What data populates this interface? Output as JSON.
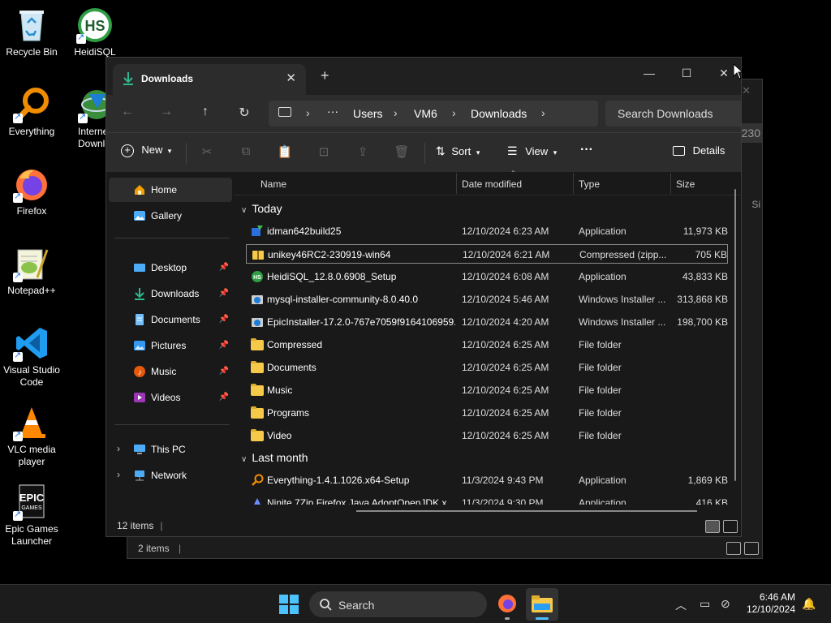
{
  "desktop": {
    "icons": [
      {
        "label": "Recycle Bin"
      },
      {
        "label": "HeidiSQL"
      },
      {
        "label": "Everything"
      },
      {
        "label": "Interne Downlo"
      },
      {
        "label": "Firefox"
      },
      {
        "label": "Notepad++"
      },
      {
        "label": "Visual Studio Code"
      },
      {
        "label": "VLC media player"
      },
      {
        "label": "Epic Games Launcher"
      }
    ]
  },
  "bg_window": {
    "status_count": "2 items",
    "peek_text": "230",
    "peek_col": "Si"
  },
  "explorer": {
    "tab_title": "Downloads",
    "breadcrumbs": [
      "Users",
      "VM6",
      "Downloads"
    ],
    "search_placeholder": "Search Downloads",
    "commands": {
      "new": "New",
      "sort": "Sort",
      "view": "View",
      "details": "Details"
    },
    "sidebar": {
      "items": [
        {
          "label": "Home"
        },
        {
          "label": "Gallery"
        },
        {
          "label": "Desktop"
        },
        {
          "label": "Downloads"
        },
        {
          "label": "Documents"
        },
        {
          "label": "Pictures"
        },
        {
          "label": "Music"
        },
        {
          "label": "Videos"
        },
        {
          "label": "This PC"
        },
        {
          "label": "Network"
        }
      ]
    },
    "columns": {
      "name": "Name",
      "date": "Date modified",
      "type": "Type",
      "size": "Size"
    },
    "groups": {
      "today": "Today",
      "last_month": "Last month"
    },
    "today_files": [
      {
        "name": "idman642build25",
        "date": "12/10/2024 6:23 AM",
        "type": "Application",
        "size": "11,973 KB"
      },
      {
        "name": "unikey46RC2-230919-win64",
        "date": "12/10/2024 6:21 AM",
        "type": "Compressed (zipp...",
        "size": "705 KB"
      },
      {
        "name": "HeidiSQL_12.8.0.6908_Setup",
        "date": "12/10/2024 6:08 AM",
        "type": "Application",
        "size": "43,833 KB"
      },
      {
        "name": "mysql-installer-community-8.0.40.0",
        "date": "12/10/2024 5:46 AM",
        "type": "Windows Installer ...",
        "size": "313,868 KB"
      },
      {
        "name": "EpicInstaller-17.2.0-767e7059f9164106959...",
        "date": "12/10/2024 4:20 AM",
        "type": "Windows Installer ...",
        "size": "198,700 KB"
      },
      {
        "name": "Compressed",
        "date": "12/10/2024 6:25 AM",
        "type": "File folder",
        "size": ""
      },
      {
        "name": "Documents",
        "date": "12/10/2024 6:25 AM",
        "type": "File folder",
        "size": ""
      },
      {
        "name": "Music",
        "date": "12/10/2024 6:25 AM",
        "type": "File folder",
        "size": ""
      },
      {
        "name": "Programs",
        "date": "12/10/2024 6:25 AM",
        "type": "File folder",
        "size": ""
      },
      {
        "name": "Video",
        "date": "12/10/2024 6:25 AM",
        "type": "File folder",
        "size": ""
      }
    ],
    "last_month_files": [
      {
        "name": "Everything-1.4.1.1026.x64-Setup",
        "date": "11/3/2024 9:43 PM",
        "type": "Application",
        "size": "1,869 KB"
      },
      {
        "name": "Ninite 7Zip Firefox Java AdoptOpenJDK x...",
        "date": "11/3/2024 9:30 PM",
        "type": "Application",
        "size": "416 KB"
      }
    ],
    "status_count": "12 items"
  },
  "taskbar": {
    "search_label": "Search",
    "time": "6:46 AM",
    "date": "12/10/2024"
  }
}
